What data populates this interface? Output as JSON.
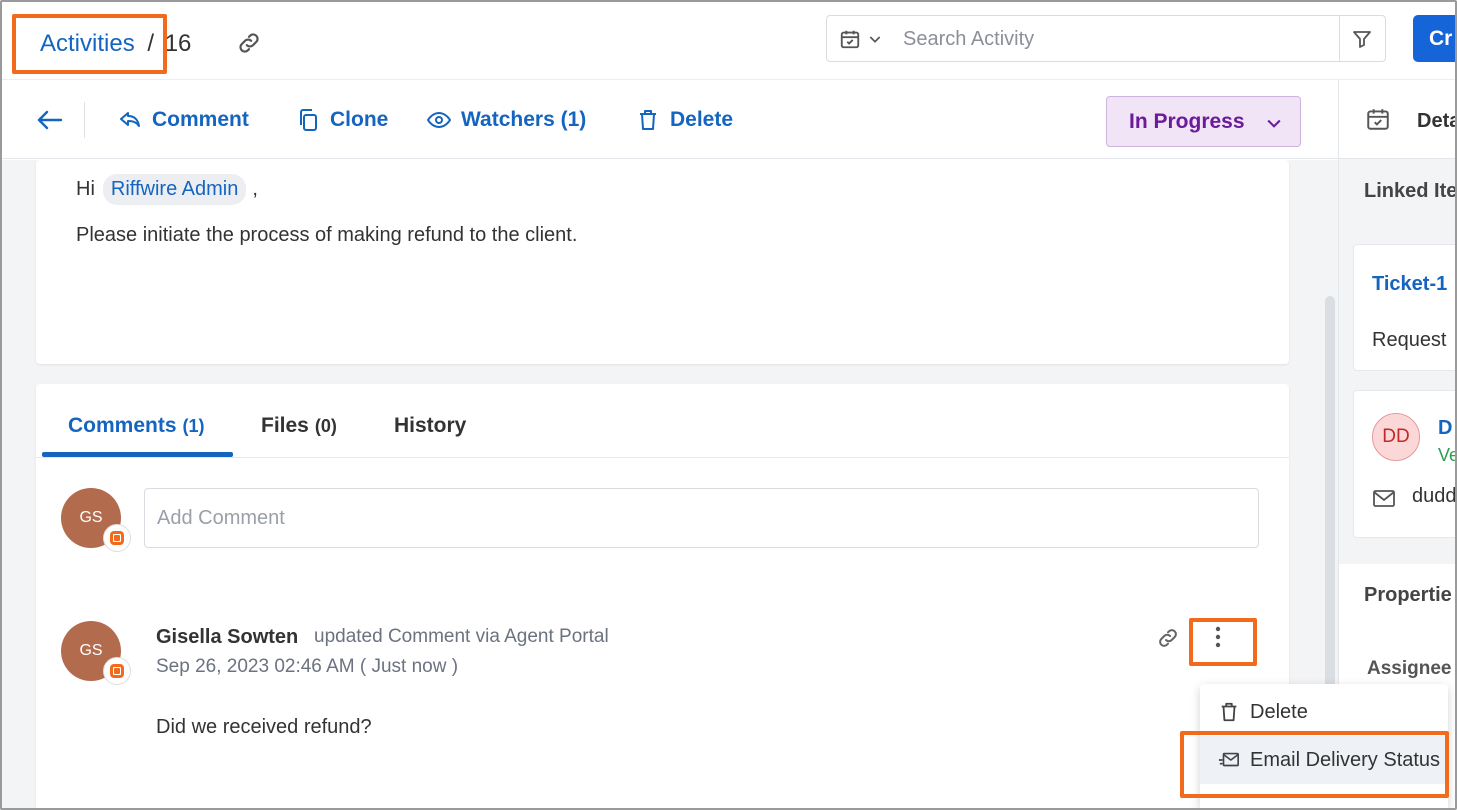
{
  "header": {
    "breadcrumb_link": "Activities",
    "breadcrumb_sep": "/",
    "record_number": "16",
    "search_placeholder": "Search Activity",
    "create_label": "Cr"
  },
  "toolbar": {
    "comment_label": "Comment",
    "clone_label": "Clone",
    "watchers_label": "Watchers (1)",
    "delete_label": "Delete",
    "status_value": "In Progress"
  },
  "description": {
    "greeting": "Hi",
    "mention": "Riffwire Admin",
    "comma": ",",
    "body": "Please initiate the process of making refund to the client."
  },
  "tabs": [
    {
      "label": "Comments",
      "count": "(1)",
      "active": true
    },
    {
      "label": "Files",
      "count": "(0)",
      "active": false
    },
    {
      "label": "History",
      "count": "",
      "active": false
    }
  ],
  "composer": {
    "avatar_initials": "GS",
    "placeholder": "Add Comment"
  },
  "comment": {
    "avatar_initials": "GS",
    "author": "Gisella Sowten",
    "action": "updated Comment via Agent Portal",
    "timestamp": "Sep 26, 2023 02:46 AM ( Just now )",
    "text": "Did we received refund?"
  },
  "menu": {
    "items": [
      {
        "label": "Delete",
        "icon": "trash-icon"
      },
      {
        "label": "Email Delivery Status",
        "icon": "email-send-icon"
      }
    ]
  },
  "right_panel": {
    "header_label": "Deta",
    "linked_items_title": "Linked Ite",
    "ticket_link": "Ticket-1",
    "ticket_sub": "Request",
    "contact_initials": "DD",
    "contact_name": "D",
    "contact_sub": "Ve",
    "contact_email": "dudd",
    "properties_title": "Propertie",
    "assignee_label": "Assignee"
  },
  "colors": {
    "accent": "#1565c0",
    "highlight": "#f26b1d",
    "status_bg": "#f1e4f7",
    "status_text": "#6a1b9a"
  }
}
